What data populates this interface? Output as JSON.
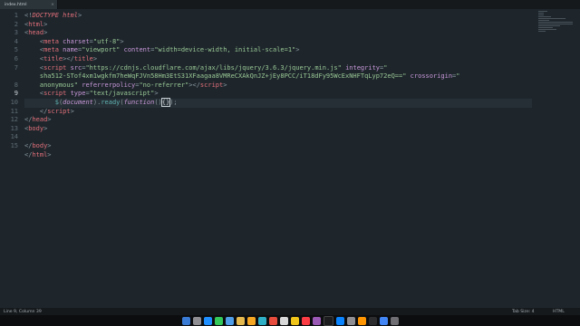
{
  "tab": {
    "label": "index.html",
    "close_glyph": "×"
  },
  "gutter": [
    "1",
    "2",
    "3",
    "4",
    "5",
    "6",
    "7",
    "",
    "8",
    "9",
    "10",
    "11",
    "12",
    "13",
    "14",
    "15"
  ],
  "status": {
    "position": "Line 9, Column 39",
    "tab_size": "Tab Size: 4",
    "syntax": "HTML"
  },
  "colors": {
    "background": "#1e262c",
    "tag": "#e4707a",
    "attribute": "#c897d8",
    "string": "#99c794",
    "function": "#5fb3b3"
  },
  "code_lines": [
    [
      [
        "p",
        "<!"
      ],
      [
        "d",
        "DOCTYPE html"
      ],
      [
        "p",
        ">"
      ]
    ],
    [
      [
        "p",
        "<"
      ],
      [
        "t",
        "html"
      ],
      [
        "p",
        ">"
      ]
    ],
    [
      [
        "p",
        "<"
      ],
      [
        "t",
        "head"
      ],
      [
        "p",
        ">"
      ]
    ],
    [
      [
        "x",
        "    "
      ],
      [
        "p",
        "<"
      ],
      [
        "t",
        "meta"
      ],
      [
        "x",
        " "
      ],
      [
        "a",
        "charset"
      ],
      [
        "p",
        "="
      ],
      [
        "s",
        "\"utf-8\""
      ],
      [
        "p",
        ">"
      ]
    ],
    [
      [
        "x",
        "    "
      ],
      [
        "p",
        "<"
      ],
      [
        "t",
        "meta"
      ],
      [
        "x",
        " "
      ],
      [
        "a",
        "name"
      ],
      [
        "p",
        "="
      ],
      [
        "s",
        "\"viewport\""
      ],
      [
        "x",
        " "
      ],
      [
        "a",
        "content"
      ],
      [
        "p",
        "="
      ],
      [
        "s",
        "\"width=device-width, initial-scale=1\""
      ],
      [
        "p",
        ">"
      ]
    ],
    [
      [
        "x",
        "    "
      ],
      [
        "p",
        "<"
      ],
      [
        "t",
        "title"
      ],
      [
        "p",
        "></"
      ],
      [
        "t",
        "title"
      ],
      [
        "p",
        ">"
      ]
    ],
    [
      [
        "x",
        "    "
      ],
      [
        "p",
        "<"
      ],
      [
        "t",
        "script"
      ],
      [
        "x",
        " "
      ],
      [
        "a",
        "src"
      ],
      [
        "p",
        "="
      ],
      [
        "s",
        "\"https://cdnjs.cloudflare.com/ajax/libs/jquery/3.6.3/jquery.min.js\""
      ],
      [
        "x",
        " "
      ],
      [
        "a",
        "integrity"
      ],
      [
        "p",
        "="
      ],
      [
        "s",
        "\""
      ]
    ],
    [
      [
        "s",
        "    sha512-STof4xm1wgkfm7heWqFJVn58Hm3EtS31XFaagaa8VMReCXAkQnJZ+jEy8PCC/iT18dFy95WcExNHFTqLyp72eQ=="
      ],
      [
        "s",
        "\""
      ],
      [
        "x",
        " "
      ],
      [
        "a",
        "crossorigin"
      ],
      [
        "p",
        "="
      ],
      [
        "s",
        "\""
      ]
    ],
    [
      [
        "s",
        "    anonymous\""
      ],
      [
        "x",
        " "
      ],
      [
        "a",
        "referrerpolicy"
      ],
      [
        "p",
        "="
      ],
      [
        "s",
        "\"no-referrer\""
      ],
      [
        "p",
        "></"
      ],
      [
        "t",
        "script"
      ],
      [
        "p",
        ">"
      ]
    ],
    [
      [
        "x",
        "    "
      ],
      [
        "p",
        "<"
      ],
      [
        "t",
        "script"
      ],
      [
        "x",
        " "
      ],
      [
        "a",
        "type"
      ],
      [
        "p",
        "="
      ],
      [
        "s",
        "\"text/javascript\""
      ],
      [
        "p",
        ">"
      ]
    ],
    [
      [
        "x",
        "        "
      ],
      [
        "f",
        "$"
      ],
      [
        "p",
        "("
      ],
      [
        "i",
        "document"
      ],
      [
        "p",
        ")."
      ],
      [
        "f",
        "ready"
      ],
      [
        "p",
        "("
      ],
      [
        "i",
        "function"
      ],
      [
        "p",
        "()"
      ],
      [
        "c",
        "{}"
      ],
      [
        "p",
        ");"
      ]
    ],
    [
      [
        "x",
        "    "
      ],
      [
        "p",
        "</"
      ],
      [
        "t",
        "script"
      ],
      [
        "p",
        ">"
      ]
    ],
    [
      [
        "p",
        "</"
      ],
      [
        "t",
        "head"
      ],
      [
        "p",
        ">"
      ]
    ],
    [
      [
        "p",
        "<"
      ],
      [
        "t",
        "body"
      ],
      [
        "p",
        ">"
      ]
    ],
    [],
    [
      [
        "p",
        "</"
      ],
      [
        "t",
        "body"
      ],
      [
        "p",
        ">"
      ]
    ],
    [
      [
        "p",
        "</"
      ],
      [
        "t",
        "html"
      ],
      [
        "p",
        ">"
      ]
    ]
  ]
}
